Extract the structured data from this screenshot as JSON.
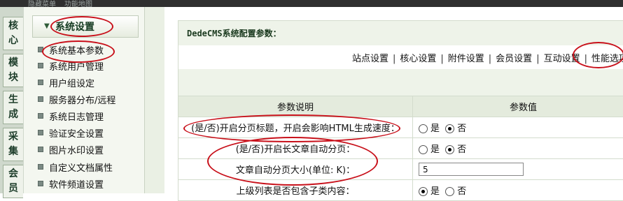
{
  "topbar": {
    "items": [
      "隐藏菜单",
      "功能地图"
    ]
  },
  "vtabs": [
    {
      "chars": [
        "核",
        "心"
      ]
    },
    {
      "chars": [
        "模",
        "块"
      ]
    },
    {
      "chars": [
        "生",
        "成"
      ]
    },
    {
      "chars": [
        "采",
        "集"
      ]
    },
    {
      "chars": [
        "会",
        "员"
      ]
    }
  ],
  "menu": {
    "heading": "系统设置",
    "items": [
      "系统基本参数",
      "系统用户管理",
      "用户组设定",
      "服务器分布/远程",
      "系统日志管理",
      "验证安全设置",
      "图片水印设置",
      "自定义文档属性",
      "软件频道设置"
    ]
  },
  "main": {
    "title": "DedeCMS系统配置参数：",
    "tabs": [
      "站点设置",
      "核心设置",
      "附件设置",
      "会员设置",
      "互动设置",
      "性能选项"
    ],
    "table": {
      "col_param": "参数说明",
      "col_value": "参数值",
      "rows": [
        {
          "label": "(是/否)开启分页标题，开启会影响HTML生成速度：",
          "yes": "是",
          "no": "否",
          "selected": "否"
        },
        {
          "label": "(是/否)开启长文章自动分页：",
          "yes": "是",
          "no": "否",
          "selected": "否"
        },
        {
          "label": "文章自动分页大小(单位: K)：",
          "value": "5"
        },
        {
          "label": "上级列表是否包含子类内容：",
          "yes": "是",
          "no": "否",
          "selected": "是"
        }
      ]
    }
  },
  "colors": {
    "annotation": "#c8101a",
    "header_bg": "#e4ebdd",
    "tab_bg": "#cfd8cc"
  }
}
